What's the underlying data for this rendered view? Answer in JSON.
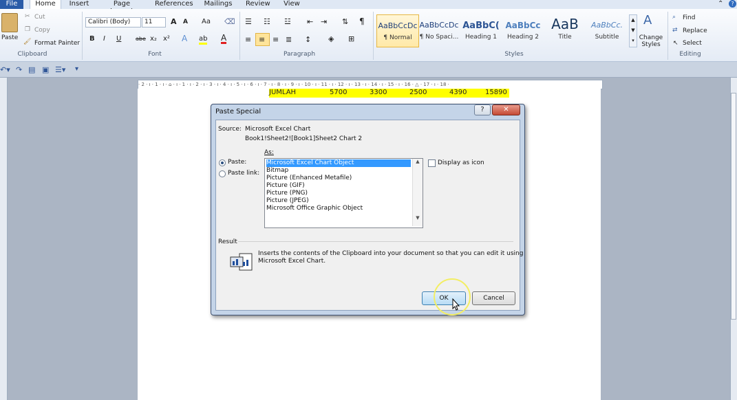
{
  "tabs": {
    "file": "File",
    "items": [
      "Home",
      "Insert",
      "Page Layout",
      "References",
      "Mailings",
      "Review",
      "View"
    ]
  },
  "clipboard": {
    "paste": "Paste",
    "cut": "Cut",
    "copy": "Copy",
    "format_painter": "Format Painter",
    "group": "Clipboard"
  },
  "font": {
    "family": "Calibri (Body)",
    "size": "11",
    "change_case": "Aa",
    "group": "Font",
    "bold": "B",
    "italic": "I",
    "underline": "U",
    "strike": "abe",
    "subscript": "x₂",
    "superscript": "x²",
    "grow": "A",
    "shrink": "A",
    "font_color": "A",
    "highlight": "ab"
  },
  "paragraph": {
    "group": "Paragraph",
    "pilcrow": "¶"
  },
  "styles": {
    "group": "Styles",
    "items": [
      {
        "preview": "AaBbCcDc",
        "name": "¶ Normal"
      },
      {
        "preview": "AaBbCcDc",
        "name": "¶ No Spaci..."
      },
      {
        "preview": "AaBbC(",
        "name": "Heading 1"
      },
      {
        "preview": "AaBbCc",
        "name": "Heading 2"
      },
      {
        "preview": "AaB",
        "name": "Title"
      },
      {
        "preview": "AaBbCc.",
        "name": "Subtitle"
      }
    ],
    "change_styles": "Change Styles"
  },
  "editing": {
    "group": "Editing",
    "find": "Find",
    "replace": "Replace",
    "select": "Select"
  },
  "document": {
    "row": [
      "JUMLAH",
      "5700",
      "3300",
      "2500",
      "4390",
      "15890"
    ]
  },
  "ruler": {
    "marks": "· 2 · ı · 1 · ı · ⌂ · ı · 1 · ı · 2 · ı · 3 · ı · 4 · ı · 5 · ı · 6 · ı · 7 · ı · 8 · ı · 9 · ı · 10 · ı · 11 · ı · 12 · ı · 13 · ı · 14 · ı · 15 · ı · 16 · △ · 17 · ı · 18 ·"
  },
  "dialog": {
    "title": "Paste Special",
    "help": "?",
    "close": "✕",
    "source_label": "Source:",
    "source_value": "Microsoft Excel Chart",
    "source_path": "Book1!Sheet2![Book1]Sheet2 Chart 2",
    "as_label": "As:",
    "paste_label": "Paste:",
    "paste_link_label": "Paste link:",
    "options": [
      "Microsoft Excel Chart Object",
      "Bitmap",
      "Picture (Enhanced Metafile)",
      "Picture (GIF)",
      "Picture (PNG)",
      "Picture (JPEG)",
      "Microsoft Office Graphic Object"
    ],
    "display_as_icon": "Display as icon",
    "result_label": "Result",
    "result_text_1": "Inserts the contents of the Clipboard into your document so that you can edit it using",
    "result_text_2": "Microsoft Excel Chart.",
    "ok": "OK",
    "cancel": "Cancel"
  }
}
